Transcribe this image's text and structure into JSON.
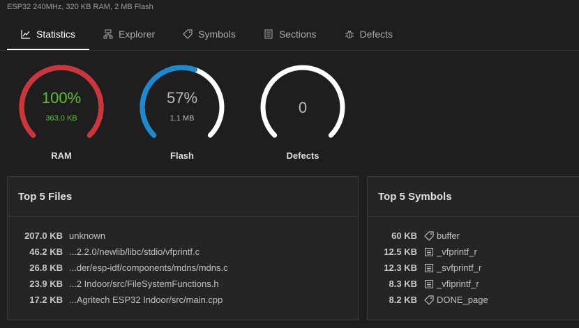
{
  "header": {
    "subtitle": "ESP32 240MHz, 320 KB RAM, 2 MB Flash"
  },
  "tabs": [
    {
      "label": "Statistics",
      "icon": "chart-line-icon",
      "active": true
    },
    {
      "label": "Explorer",
      "icon": "tree-icon",
      "active": false
    },
    {
      "label": "Symbols",
      "icon": "tag-icon",
      "active": false
    },
    {
      "label": "Sections",
      "icon": "list-icon",
      "active": false
    },
    {
      "label": "Defects",
      "icon": "bug-icon",
      "active": false
    }
  ],
  "gauges": [
    {
      "name": "RAM",
      "percent_label": "100%",
      "size_label": "363.0 KB",
      "fraction": 1.0,
      "arc_color": "#d13438",
      "text_color": "#5ec131"
    },
    {
      "name": "Flash",
      "percent_label": "57%",
      "size_label": "1.1 MB",
      "fraction": 0.57,
      "arc_color": "#1a8ad4",
      "text_color": "#bbbbbb"
    },
    {
      "name": "Defects",
      "percent_label": "0",
      "size_label": "",
      "fraction": 0,
      "arc_color": "#ffffff",
      "text_color": "#bbbbbb"
    }
  ],
  "colors": {
    "track": "#ffffff",
    "background": "#1e1e1e",
    "card": "#252526"
  },
  "top_files": {
    "title": "Top 5 Files",
    "rows": [
      {
        "size": "207.0 KB",
        "name": "unknown"
      },
      {
        "size": "46.2 KB",
        "name": "...2.2.0/newlib/libc/stdio/vfprintf.c"
      },
      {
        "size": "26.8 KB",
        "name": "...der/esp-idf/components/mdns/mdns.c"
      },
      {
        "size": "23.9 KB",
        "name": "...2 Indoor/src/FileSystemFunctions.h"
      },
      {
        "size": "17.2 KB",
        "name": "...Agritech ESP32 Indoor/src/main.cpp"
      }
    ]
  },
  "top_symbols": {
    "title": "Top 5 Symbols",
    "rows": [
      {
        "size": "60 KB",
        "name": "buffer",
        "icon": "tag-icon"
      },
      {
        "size": "12.5 KB",
        "name": "_vfprintf_r",
        "icon": "function-icon"
      },
      {
        "size": "12.3 KB",
        "name": "_svfprintf_r",
        "icon": "function-icon"
      },
      {
        "size": "8.3 KB",
        "name": "_vfiprintf_r",
        "icon": "function-icon"
      },
      {
        "size": "8.2 KB",
        "name": "DONE_page",
        "icon": "tag-icon"
      }
    ]
  }
}
